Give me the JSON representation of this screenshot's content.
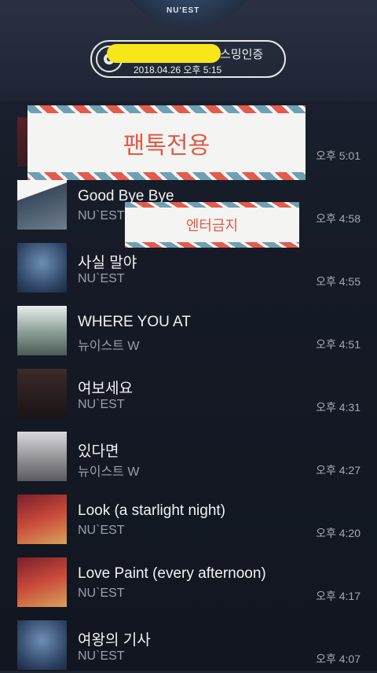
{
  "header": {
    "album_logo": "NU'EST",
    "stream_title": "스밍인증",
    "stream_datetime": "2018.04.26 오후 5:15"
  },
  "overlays": {
    "stamp1": "팬톡전용",
    "stamp2": "엔터금지"
  },
  "tracks": [
    {
      "title": "",
      "artist": "",
      "time": "오후 5:01",
      "art": "dark"
    },
    {
      "title": "Good Bye Bye",
      "artist": "NU`EST",
      "time": "오후 4:58",
      "art": "light"
    },
    {
      "title": "사실 말야",
      "artist": "NU`EST",
      "time": "오후 4:55",
      "art": "blue"
    },
    {
      "title": "WHERE YOU AT",
      "artist": "뉴이스트 W",
      "time": "오후 4:51",
      "art": "gray"
    },
    {
      "title": "여보세요",
      "artist": "NU`EST",
      "time": "오후 4:31",
      "art": "group"
    },
    {
      "title": "있다면",
      "artist": "뉴이스트 W",
      "time": "오후 4:27",
      "art": "bw"
    },
    {
      "title": "Look (a starlight night)",
      "artist": "NU`EST",
      "time": "오후 4:20",
      "art": "red"
    },
    {
      "title": "Love Paint (every afternoon)",
      "artist": "NU`EST",
      "time": "오후 4:17",
      "art": "red"
    },
    {
      "title": "여왕의 기사",
      "artist": "NU`EST",
      "time": "오후 4:07",
      "art": "blue"
    }
  ]
}
